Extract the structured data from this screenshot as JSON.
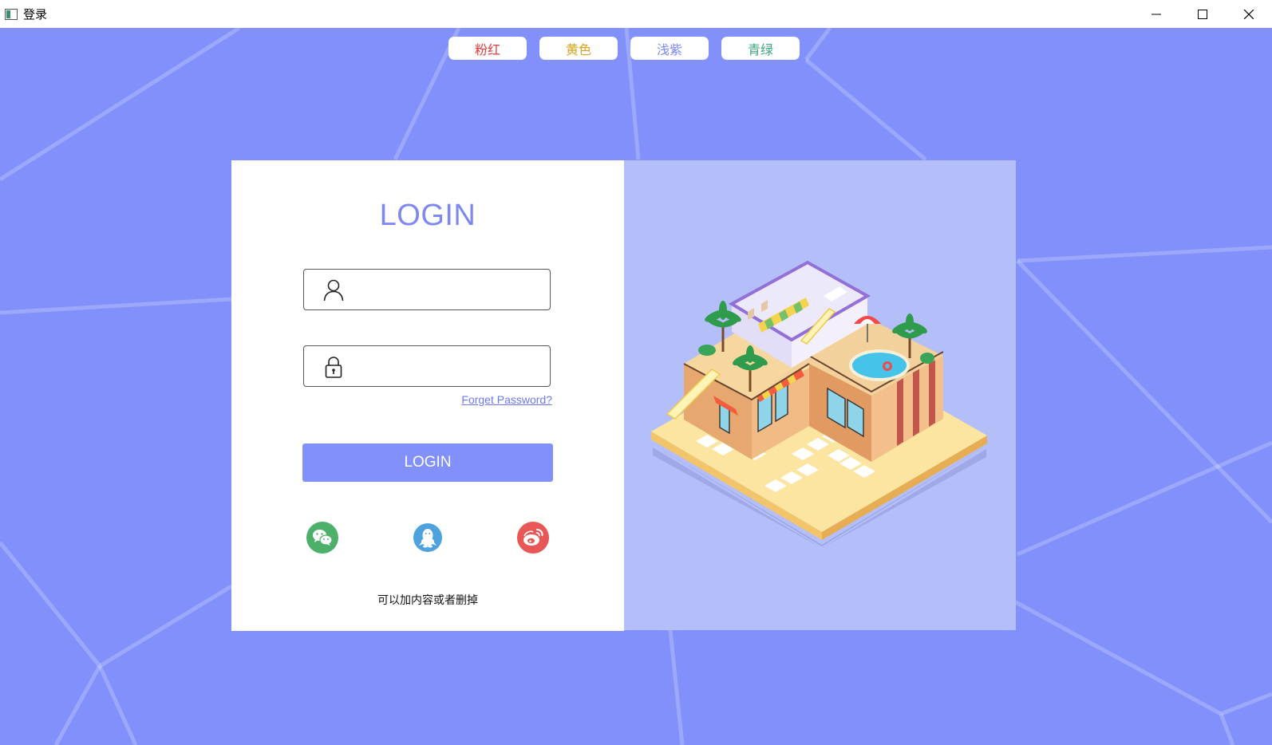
{
  "window": {
    "title": "登录",
    "controls": [
      "minimize",
      "maximize",
      "close"
    ]
  },
  "theme_buttons": [
    {
      "label": "粉红",
      "color": "#e33b3b"
    },
    {
      "label": "黄色",
      "color": "#d9a31b"
    },
    {
      "label": "浅紫",
      "color": "#7d88f2"
    },
    {
      "label": "青绿",
      "color": "#3fa37c"
    }
  ],
  "login": {
    "title": "LOGIN",
    "username": {
      "value": "",
      "placeholder": "",
      "icon": "user-icon"
    },
    "password": {
      "value": "",
      "placeholder": "",
      "icon": "lock-icon"
    },
    "forget_link": "Forget Password?",
    "submit_label": "LOGIN",
    "social": [
      {
        "name": "wechat",
        "icon": "wechat-icon",
        "color": "#4cb06a"
      },
      {
        "name": "qq",
        "icon": "qq-icon",
        "color": "#4ea3df"
      },
      {
        "name": "weibo",
        "icon": "weibo-icon",
        "color": "#e95656"
      }
    ],
    "footer_note": "可以加内容或者删掉"
  },
  "colors": {
    "background": "#8190fa",
    "accent": "#7d88f2",
    "illustration_panel": "#b4bff9"
  }
}
